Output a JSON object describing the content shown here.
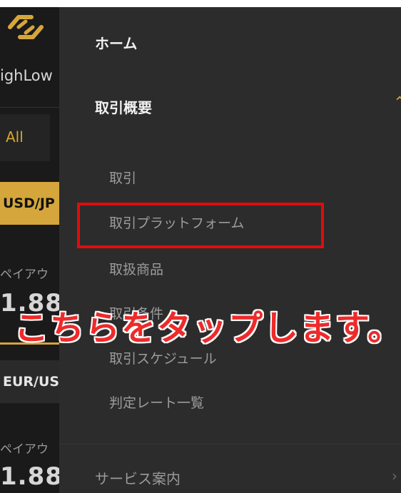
{
  "background_app": {
    "brand": "ighLow",
    "filter_label": "All",
    "pairs": [
      {
        "label": "USD/JP",
        "payout_label": "ペイアウ",
        "payout_value": "1.88"
      },
      {
        "label": "EUR/US",
        "payout_label": "ペイアウ",
        "payout_value": "1.88"
      }
    ],
    "colors": {
      "accent": "#d5a63b",
      "background": "#1a1a1a"
    }
  },
  "drawer": {
    "main_items": [
      {
        "label": "ホーム"
      },
      {
        "label": "取引概要"
      },
      {
        "label": "サービス案内"
      }
    ],
    "sub_items": [
      {
        "label": "取引"
      },
      {
        "label": "取引プラットフォーム"
      },
      {
        "label": "取扱商品"
      },
      {
        "label": "取引条件"
      },
      {
        "label": "取引スケジュール"
      },
      {
        "label": "判定レート一覧"
      }
    ],
    "colors": {
      "background": "#2c2c2c",
      "chevron": "#c8a33a"
    }
  },
  "annotation": {
    "callout": "こちらをタップします。",
    "highlight_color": "#e20b0b"
  }
}
